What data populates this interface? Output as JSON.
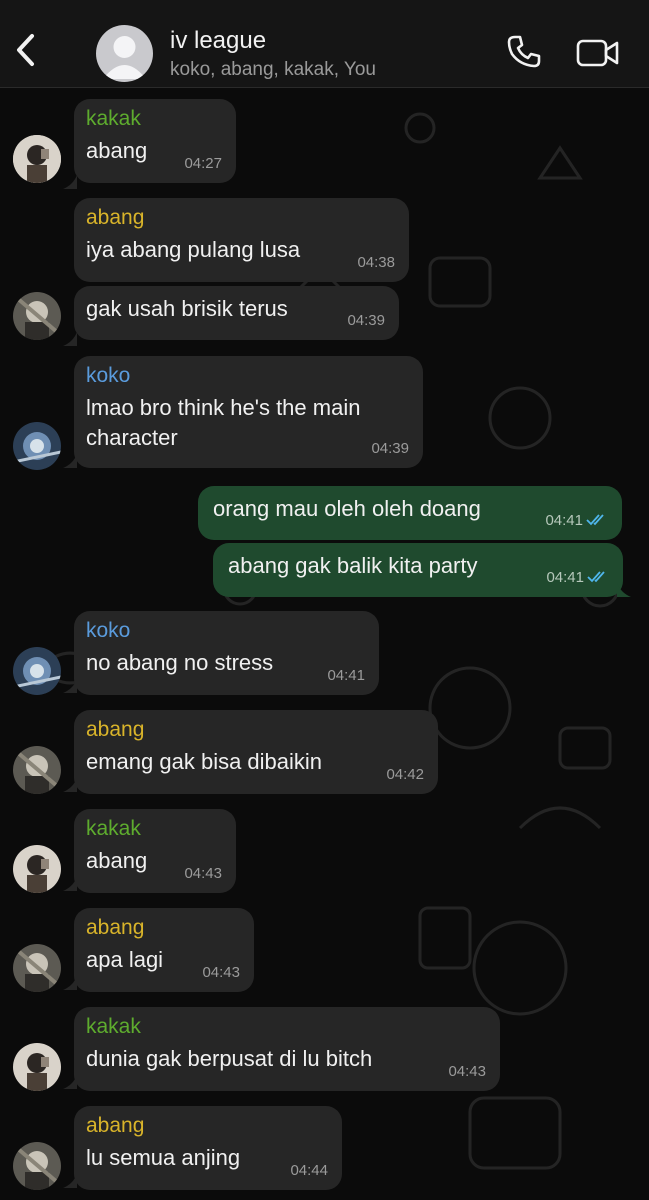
{
  "header": {
    "title": "iv league",
    "subtitle": "koko, abang, kakak, You",
    "icons": {
      "back": "chevron-left-icon",
      "call": "phone-icon",
      "video": "video-camera-icon",
      "group_avatar": "person-silhouette-icon"
    }
  },
  "colors": {
    "kakak": "#5eac2e",
    "abang": "#d9b42a",
    "koko": "#5a9bdc",
    "outgoing_bubble": "#1f4a2e",
    "incoming_bubble": "#262626",
    "read_ticks": "#4fb6ec"
  },
  "messages": [
    {
      "sender": "kakak",
      "text": "abang",
      "time": "04:27"
    },
    {
      "sender": "abang",
      "text": "iya abang pulang lusa",
      "time": "04:38"
    },
    {
      "sender": "",
      "text": "gak usah brisik terus",
      "time": "04:39"
    },
    {
      "sender": "koko",
      "text": "lmao bro think he's the main character",
      "time": "04:39"
    },
    {
      "sender": "You",
      "text": "orang mau oleh oleh doang",
      "time": "04:41",
      "status": "read"
    },
    {
      "sender": "You",
      "text": "abang gak balik kita party",
      "time": "04:41",
      "status": "read"
    },
    {
      "sender": "koko",
      "text": "no abang no stress",
      "time": "04:41"
    },
    {
      "sender": "abang",
      "text": "emang gak bisa dibaikin",
      "time": "04:42"
    },
    {
      "sender": "kakak",
      "text": "abang",
      "time": "04:43"
    },
    {
      "sender": "abang",
      "text": "apa lagi",
      "time": "04:43"
    },
    {
      "sender": "kakak",
      "text": "dunia gak berpusat di lu bitch",
      "time": "04:43"
    },
    {
      "sender": "abang",
      "text": "lu semua anjing",
      "time": "04:44"
    }
  ]
}
